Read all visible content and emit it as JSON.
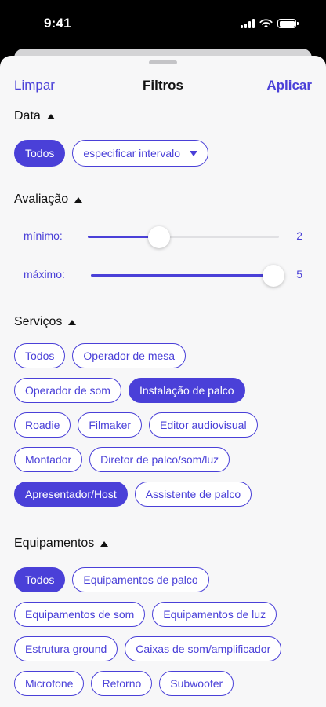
{
  "status_bar": {
    "time": "9:41"
  },
  "header": {
    "clear_label": "Limpar",
    "title": "Filtros",
    "apply_label": "Aplicar"
  },
  "date_section": {
    "title": "Data",
    "all_label": "Todos",
    "range_label": "especificar intervalo"
  },
  "rating_section": {
    "title": "Avaliação",
    "min_label": "mínimo:",
    "min_value": "2",
    "max_label": "máximo:",
    "max_value": "5",
    "scale_max": 5
  },
  "services_section": {
    "title": "Serviços",
    "rows": [
      [
        {
          "label": "Todos",
          "selected": false
        },
        {
          "label": "Operador de mesa",
          "selected": false
        }
      ],
      [
        {
          "label": "Operador de som",
          "selected": false
        },
        {
          "label": "Instalação de palco",
          "selected": true
        }
      ],
      [
        {
          "label": "Roadie",
          "selected": false
        },
        {
          "label": "Filmaker",
          "selected": false
        },
        {
          "label": "Editor audiovisual",
          "selected": false
        }
      ],
      [
        {
          "label": "Montador",
          "selected": false
        },
        {
          "label": "Diretor de palco/som/luz",
          "selected": false
        }
      ],
      [
        {
          "label": "Apresentador/Host",
          "selected": true
        },
        {
          "label": "Assistente de palco",
          "selected": false
        }
      ]
    ]
  },
  "equipment_section": {
    "title": "Equipamentos",
    "rows": [
      [
        {
          "label": "Todos",
          "selected": true
        },
        {
          "label": "Equipamentos de palco",
          "selected": false
        }
      ],
      [
        {
          "label": "Equipamentos de som",
          "selected": false
        },
        {
          "label": "Equipamentos de luz",
          "selected": false
        }
      ],
      [
        {
          "label": "Estrutura ground",
          "selected": false
        },
        {
          "label": "Caixas de som/amplificador",
          "selected": false
        }
      ],
      [
        {
          "label": "Microfone",
          "selected": false
        },
        {
          "label": "Retorno",
          "selected": false
        },
        {
          "label": "Subwoofer",
          "selected": false
        }
      ]
    ]
  },
  "colors": {
    "accent": "#4a40d8",
    "sheet_bg": "#f7f7f8"
  }
}
